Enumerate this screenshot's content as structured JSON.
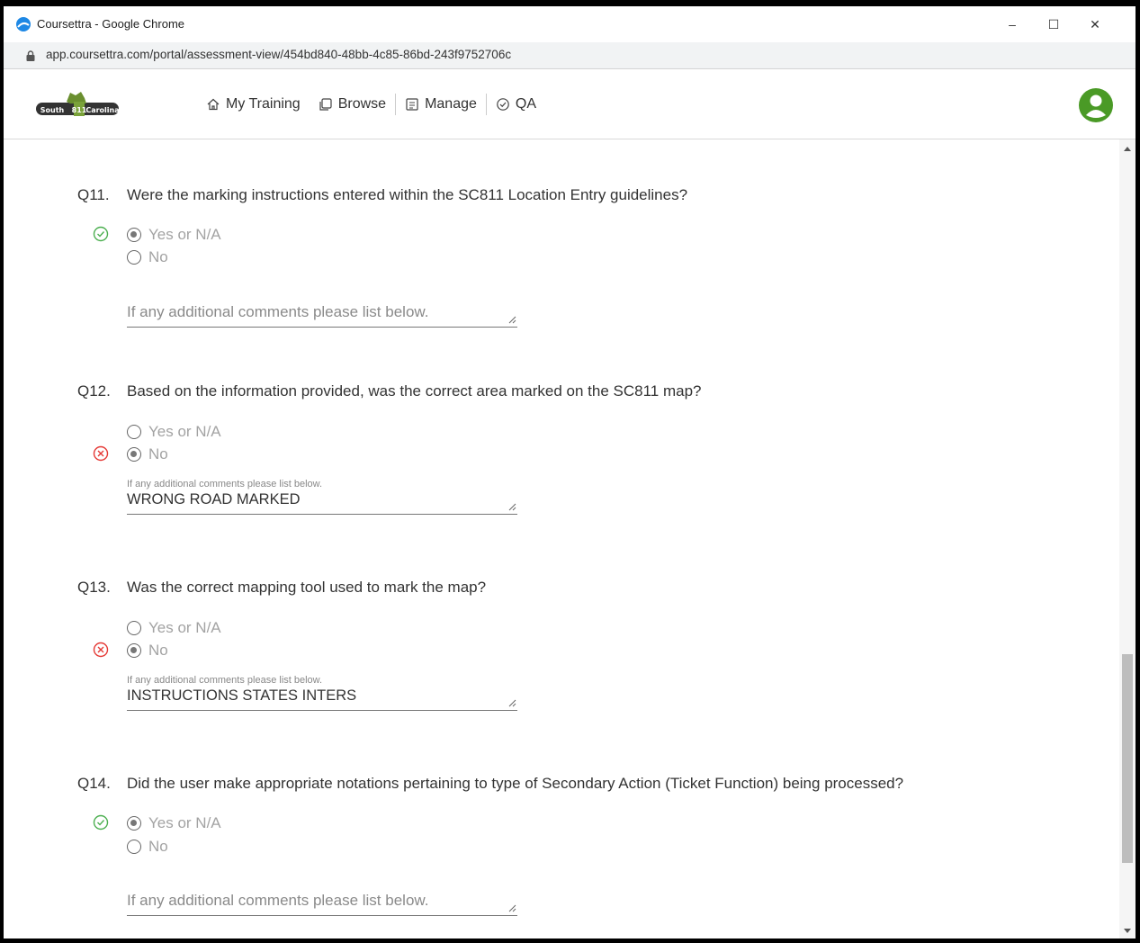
{
  "window": {
    "title": "Coursettra - Google Chrome",
    "controls": {
      "minimize": "–",
      "maximize": "☐",
      "close": "✕"
    }
  },
  "address_bar": {
    "url": "app.coursettra.com/portal/assessment-view/454bd840-48bb-4c85-86bd-243f9752706c"
  },
  "nav": {
    "items": [
      {
        "label": "My Training",
        "icon": "home-icon"
      },
      {
        "label": "Browse",
        "icon": "browse-icon"
      },
      {
        "label": "Manage",
        "icon": "manage-icon"
      },
      {
        "label": "QA",
        "icon": "check-circle-icon"
      }
    ],
    "brand_text": "South 811 Carolina"
  },
  "colors": {
    "correct": "#4caf50",
    "incorrect": "#e53935"
  },
  "questions": [
    {
      "number": "Q11.",
      "text": "Were the marking instructions entered within the SC811 Location Entry guidelines?",
      "status": "correct",
      "options": [
        "Yes or N/A",
        "No"
      ],
      "selected": "Yes or N/A",
      "comment_placeholder": "If any additional comments please list below.",
      "comment_value": ""
    },
    {
      "number": "Q12.",
      "text": "Based on the information provided, was the correct area marked on the SC811 map?",
      "status": "incorrect",
      "options": [
        "Yes or N/A",
        "No"
      ],
      "selected": "No",
      "comment_label": "If any additional comments please list below.",
      "comment_value": "WRONG ROAD MARKED"
    },
    {
      "number": "Q13.",
      "text": " Was the correct mapping tool used to mark the map?",
      "status": "incorrect",
      "options": [
        "Yes or N/A",
        "No"
      ],
      "selected": "No",
      "comment_label": "If any additional comments please list below.",
      "comment_value": "INSTRUCTIONS STATES INTERS"
    },
    {
      "number": "Q14.",
      "text": "Did the user make appropriate notations pertaining to type of Secondary Action (Ticket Function) being processed?",
      "status": "correct",
      "options": [
        "Yes or N/A",
        "No"
      ],
      "selected": "Yes or N/A",
      "comment_placeholder": "If any additional comments please list below.",
      "comment_value": ""
    }
  ]
}
